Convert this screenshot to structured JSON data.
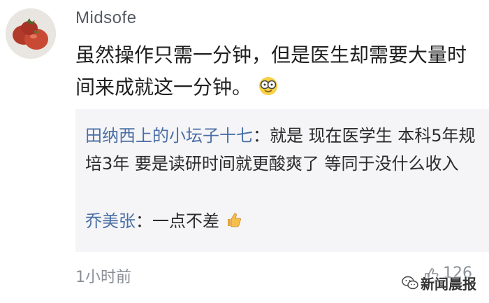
{
  "comment": {
    "username": "Midsofe",
    "text": "虽然操作只需一分钟，但是医生却需要大量时间来成就这一分钟。",
    "time": "1小时前",
    "like_count": "126"
  },
  "replies": [
    {
      "user": "田纳西上的小坛子十七",
      "separator": "：",
      "text": "就是 现在医学生 本科5年规培3年 要是读研时间就更酸爽了 等同于没什么收入"
    },
    {
      "user": "乔美张",
      "separator": "：",
      "text": "一点不差"
    }
  ],
  "watermark": {
    "text": "新闻晨报"
  },
  "icons": {
    "avatar": "tomato-photo-avatar",
    "emoji": "nerd-glasses-emoji",
    "reply_emoji": "thumbs-up-emoji",
    "like": "thumbs-up-icon",
    "watermark": "wechat-logo-icon"
  }
}
